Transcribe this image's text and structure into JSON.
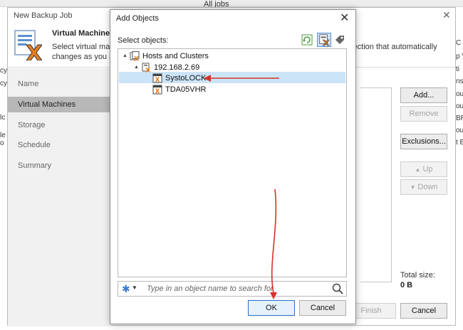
{
  "background": {
    "title_fragment": "All jobs",
    "left_fragments": [
      "cy",
      "cy",
      "lc",
      "le",
      "o"
    ],
    "right_fragments": [
      "C",
      "p V",
      "ti",
      "nst",
      "ou",
      "ou",
      "BR",
      "ou",
      "t B"
    ]
  },
  "wizard": {
    "title": "New Backup Job",
    "step_title": "Virtual Machines",
    "step_desc_line1": "Select virtual machi",
    "step_desc_line2": "changes as you add",
    "step_desc_right": "election that automatically",
    "nav": [
      "Name",
      "Virtual Machines",
      "Storage",
      "Schedule",
      "Summary"
    ],
    "active_nav": 1,
    "buttons": {
      "add": "Add...",
      "remove": "Remove",
      "exclusions": "Exclusions...",
      "up": "Up",
      "down": "Down",
      "finish": "Finish",
      "cancel": "Cancel"
    },
    "total_size_label": "Total size:",
    "total_size_value": "0 B"
  },
  "dialog": {
    "title": "Add Objects",
    "select_label": "Select objects:",
    "tree": [
      {
        "label": "Hosts and Clusters",
        "level": 0,
        "expanded": true
      },
      {
        "label": "192.168.2.69",
        "level": 1,
        "expanded": true
      },
      {
        "label": "SystoLOCK",
        "level": 2,
        "selected": true
      },
      {
        "label": "TDA05VHR",
        "level": 2,
        "selected": false
      }
    ],
    "search_placeholder": "Type in an object name to search for",
    "ok": "OK",
    "cancel": "Cancel"
  },
  "annotation_color": "#d9312b",
  "selection_color": "#cce4f7"
}
